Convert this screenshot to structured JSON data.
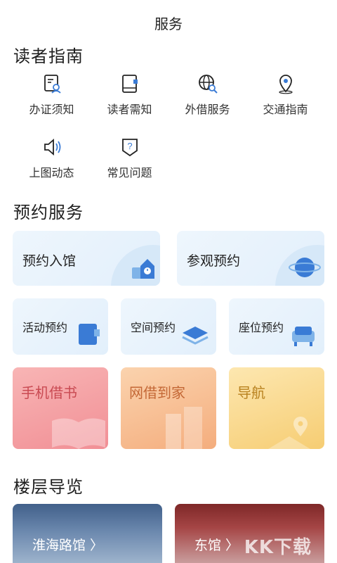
{
  "header": {
    "title": "服务"
  },
  "reader_guide": {
    "title": "读者指南",
    "items": [
      {
        "label": "办证须知",
        "icon": "id-card-icon"
      },
      {
        "label": "读者需知",
        "icon": "notebook-icon"
      },
      {
        "label": "外借服务",
        "icon": "globe-search-icon"
      },
      {
        "label": "交通指南",
        "icon": "location-pin-icon"
      },
      {
        "label": "上图动态",
        "icon": "speaker-icon"
      },
      {
        "label": "常见问题",
        "icon": "question-icon"
      }
    ]
  },
  "booking": {
    "title": "预约服务",
    "big_cards": [
      {
        "label": "预约入馆",
        "icon": "building-clock-icon"
      },
      {
        "label": "参观预约",
        "icon": "planet-icon"
      }
    ],
    "small_cards": [
      {
        "label": "活动预约",
        "icon": "calendar-book-icon"
      },
      {
        "label": "空间预约",
        "icon": "layers-icon"
      },
      {
        "label": "座位预约",
        "icon": "sofa-icon"
      }
    ],
    "color_cards": [
      {
        "label": "手机借书",
        "icon": "open-book-icon"
      },
      {
        "label": "网借到家",
        "icon": "buildings-icon"
      },
      {
        "label": "导航",
        "icon": "map-pin-icon"
      }
    ]
  },
  "floor_guide": {
    "title": "楼层导览",
    "halls": [
      {
        "label": "淮海路馆 〉"
      },
      {
        "label": "东馆 〉"
      }
    ]
  },
  "watermark": {
    "text": "KK下载"
  },
  "colors": {
    "accent_blue": "#3a7bd5",
    "card_blue": "#e6f1fb",
    "pink": "#f18f95",
    "orange": "#f4ad7d",
    "yellow": "#f6cd73"
  }
}
